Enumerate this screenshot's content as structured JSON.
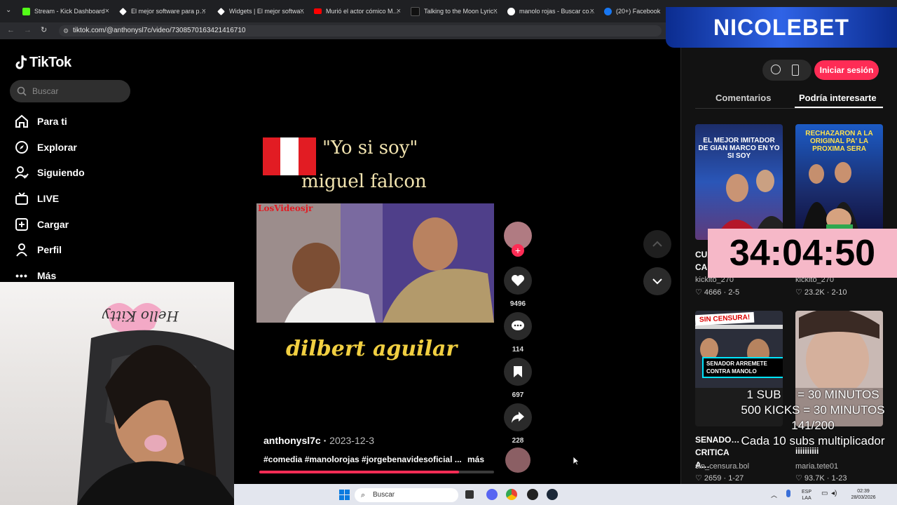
{
  "browser": {
    "tabs": [
      {
        "label": "Stream - Kick Dashboard",
        "color": "#53fc18"
      },
      {
        "label": "El mejor software para p…",
        "color": "#ffffff"
      },
      {
        "label": "Widgets | El mejor softwa…",
        "color": "#ffffff"
      },
      {
        "label": "Murió el actor cómico M…",
        "color": "#ff0000"
      },
      {
        "label": "Talking to the Moon Lyric…",
        "color": "#111111"
      },
      {
        "label": "manolo rojas - Buscar co…",
        "color": "#4285f4"
      },
      {
        "label": "(20+) Facebook",
        "color": "#1877f2"
      }
    ],
    "url": "tiktok.com/@anthonysl7c/video/7308570163421416710"
  },
  "tiktok": {
    "logo": "TikTok",
    "search_placeholder": "Buscar",
    "nav": [
      {
        "label": "Para ti",
        "icon": "home-icon"
      },
      {
        "label": "Explorar",
        "icon": "compass-icon"
      },
      {
        "label": "Siguiendo",
        "icon": "following-icon"
      },
      {
        "label": "LIVE",
        "icon": "live-icon"
      },
      {
        "label": "Cargar",
        "icon": "upload-icon"
      },
      {
        "label": "Perfil",
        "icon": "profile-icon"
      },
      {
        "label": "Más",
        "icon": "more-icon"
      }
    ],
    "video": {
      "line1": "\"Yo si soy\"",
      "line2": "miguel falcon",
      "watermark": "LosVideosjr",
      "line3": "dilbert aguilar",
      "author": "anthonysl7c",
      "date": "2023-12-3",
      "description": "#comedia #manolorojas #jorgebenavidesoficial ...",
      "more": "más",
      "progress": 0.85
    },
    "actions": {
      "likes": "9496",
      "comments": "114",
      "saves": "697",
      "shares": "228"
    },
    "right": {
      "login": "Iniciar sesión",
      "tab_comments": "Comentarios",
      "tab_interest": "Podría interesarte",
      "cards": [
        {
          "caption": "EL MEJOR IMITADOR DE GIAN MARCO EN YO SI SOY",
          "title": "CUA… CA…",
          "account": "kickito_270",
          "likes": "4666",
          "age": "2-5"
        },
        {
          "caption": "RECHAZARON A LA ORIGINAL PA' LA PROXIMA SERA",
          "title": "",
          "account": "kickito_270",
          "likes": "23.2K",
          "age": "2-10"
        },
        {
          "caption": "SENADOR ARREMETE CONTRA MANOLO",
          "badge": "SIN CENSURA!",
          "title": "SENADO… CRITICA A…",
          "account": "sin_censura.bol",
          "likes": "2659",
          "age": "1-27"
        },
        {
          "caption": "",
          "title": "iiiiiiiiii",
          "account": "maria.tete01",
          "likes": "93.7K",
          "age": "1-23"
        }
      ]
    }
  },
  "overlay": {
    "brand": "NICOLEBET",
    "timer": "34:04:50",
    "subs_lines": [
      "1 SUB     = 30 MINUTOS",
      "500 KICKS = 30 MINUTOS",
      "141/200",
      "Cada 10 subs multiplicador"
    ]
  },
  "taskbar": {
    "search": "Buscar",
    "lang": "ESP",
    "layout": "LAA",
    "time": "02:39",
    "date": "28/03/2026"
  }
}
